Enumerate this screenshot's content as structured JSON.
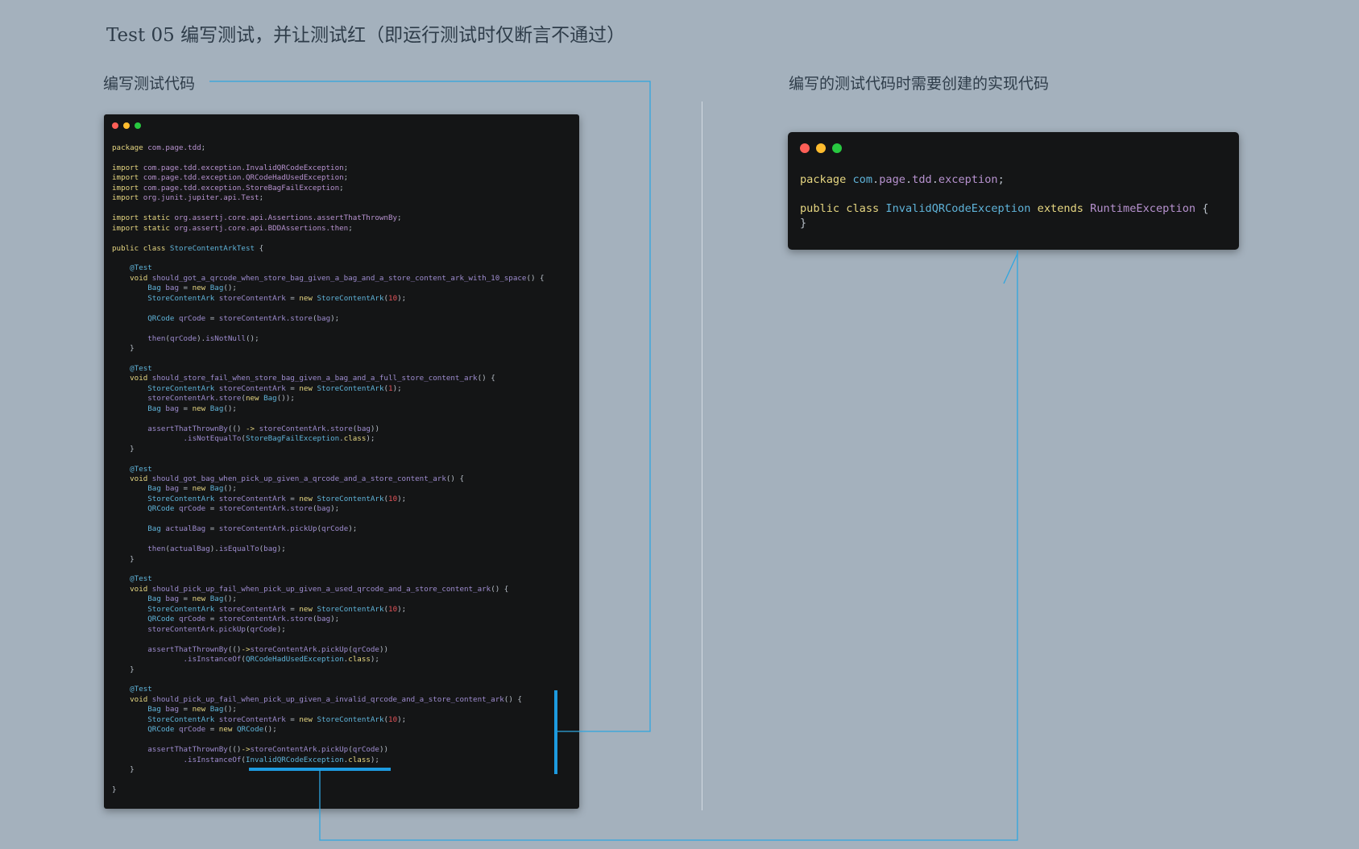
{
  "title": "Test 05 编写测试，并让测试红（即运行测试时仅断言不通过）",
  "labels": {
    "left": "编写测试代码",
    "right": "编写的测试代码时需要创建的实现代码"
  },
  "colors": {
    "background": "#a4b1bd",
    "code_background": "#141516",
    "connector": "#2fa6e0",
    "keyword": "#e6d681",
    "package": "#b792cf",
    "class": "#5fb3d9",
    "number": "#e3545a"
  },
  "left_code": [
    [
      [
        "kw",
        "package"
      ],
      [
        "pkg",
        " com.page.tdd"
      ],
      [
        "pl",
        ";"
      ]
    ],
    [],
    [
      [
        "kw",
        "import"
      ],
      [
        "pkg",
        " com.page.tdd.exception.InvalidQRCodeException"
      ],
      [
        "pl",
        ";"
      ]
    ],
    [
      [
        "kw",
        "import"
      ],
      [
        "pkg",
        " com.page.tdd.exception.QRCodeHadUsedException"
      ],
      [
        "pl",
        ";"
      ]
    ],
    [
      [
        "kw",
        "import"
      ],
      [
        "pkg",
        " com.page.tdd.exception.StoreBagFailException"
      ],
      [
        "pl",
        ";"
      ]
    ],
    [
      [
        "kw",
        "import"
      ],
      [
        "pkg",
        " org.junit.jupiter.api.Test"
      ],
      [
        "pl",
        ";"
      ]
    ],
    [],
    [
      [
        "kw",
        "import static"
      ],
      [
        "pkg",
        " org.assertj.core.api.Assertions.assertThatThrownBy"
      ],
      [
        "pl",
        ";"
      ]
    ],
    [
      [
        "kw",
        "import static"
      ],
      [
        "pkg",
        " org.assertj.core.api.BDDAssertions.then"
      ],
      [
        "pl",
        ";"
      ]
    ],
    [],
    [
      [
        "kw",
        "public class "
      ],
      [
        "cls",
        "StoreContentArkTest"
      ],
      [
        "pl",
        " {"
      ]
    ],
    [],
    [
      [
        "ann",
        "    @Test"
      ]
    ],
    [
      [
        "kw",
        "    void "
      ],
      [
        "mth",
        "should_got_a_qrcode_when_store_bag_given_a_bag_and_a_store_content_ark_with_10_space"
      ],
      [
        "pl",
        "() {"
      ]
    ],
    [
      [
        "cls",
        "        Bag"
      ],
      [
        "mth",
        " bag"
      ],
      [
        "pl",
        " = "
      ],
      [
        "kw",
        "new "
      ],
      [
        "cls",
        "Bag"
      ],
      [
        "pl",
        "();"
      ]
    ],
    [
      [
        "cls",
        "        StoreContentArk"
      ],
      [
        "mth",
        " storeContentArk"
      ],
      [
        "pl",
        " = "
      ],
      [
        "kw",
        "new "
      ],
      [
        "cls",
        "StoreContentArk"
      ],
      [
        "pl",
        "("
      ],
      [
        "num",
        "10"
      ],
      [
        "pl",
        ");"
      ]
    ],
    [],
    [
      [
        "cls",
        "        QRCode"
      ],
      [
        "mth",
        " qrCode"
      ],
      [
        "pl",
        " = "
      ],
      [
        "mth",
        "storeContentArk.store"
      ],
      [
        "pl",
        "("
      ],
      [
        "mth",
        "bag"
      ],
      [
        "pl",
        ");"
      ]
    ],
    [],
    [
      [
        "mth",
        "        then"
      ],
      [
        "pl",
        "("
      ],
      [
        "mth",
        "qrCode"
      ],
      [
        "pl",
        ")."
      ],
      [
        "mth",
        "isNotNull"
      ],
      [
        "pl",
        "();"
      ]
    ],
    [
      [
        "pl",
        "    }"
      ]
    ],
    [],
    [
      [
        "ann",
        "    @Test"
      ]
    ],
    [
      [
        "kw",
        "    void "
      ],
      [
        "mth",
        "should_store_fail_when_store_bag_given_a_bag_and_a_full_store_content_ark"
      ],
      [
        "pl",
        "() {"
      ]
    ],
    [
      [
        "cls",
        "        StoreContentArk"
      ],
      [
        "mth",
        " storeContentArk"
      ],
      [
        "pl",
        " = "
      ],
      [
        "kw",
        "new "
      ],
      [
        "cls",
        "StoreContentArk"
      ],
      [
        "pl",
        "("
      ],
      [
        "num",
        "1"
      ],
      [
        "pl",
        ");"
      ]
    ],
    [
      [
        "mth",
        "        storeContentArk.store"
      ],
      [
        "pl",
        "("
      ],
      [
        "kw",
        "new "
      ],
      [
        "cls",
        "Bag"
      ],
      [
        "pl",
        "());"
      ]
    ],
    [
      [
        "cls",
        "        Bag"
      ],
      [
        "mth",
        " bag"
      ],
      [
        "pl",
        " = "
      ],
      [
        "kw",
        "new "
      ],
      [
        "cls",
        "Bag"
      ],
      [
        "pl",
        "();"
      ]
    ],
    [],
    [
      [
        "mth",
        "        assertThatThrownBy"
      ],
      [
        "pl",
        "(() "
      ],
      [
        "kw",
        "->"
      ],
      [
        "mth",
        " storeContentArk.store"
      ],
      [
        "pl",
        "("
      ],
      [
        "mth",
        "bag"
      ],
      [
        "pl",
        "))"
      ]
    ],
    [
      [
        "mth",
        "                .isNotEqualTo"
      ],
      [
        "pl",
        "("
      ],
      [
        "cls",
        "StoreBagFailException"
      ],
      [
        "pl",
        "."
      ],
      [
        "kw",
        "class"
      ],
      [
        "pl",
        ");"
      ]
    ],
    [
      [
        "pl",
        "    }"
      ]
    ],
    [],
    [
      [
        "ann",
        "    @Test"
      ]
    ],
    [
      [
        "kw",
        "    void "
      ],
      [
        "mth",
        "should_got_bag_when_pick_up_given_a_qrcode_and_a_store_content_ark"
      ],
      [
        "pl",
        "() {"
      ]
    ],
    [
      [
        "cls",
        "        Bag"
      ],
      [
        "mth",
        " bag"
      ],
      [
        "pl",
        " = "
      ],
      [
        "kw",
        "new "
      ],
      [
        "cls",
        "Bag"
      ],
      [
        "pl",
        "();"
      ]
    ],
    [
      [
        "cls",
        "        StoreContentArk"
      ],
      [
        "mth",
        " storeContentArk"
      ],
      [
        "pl",
        " = "
      ],
      [
        "kw",
        "new "
      ],
      [
        "cls",
        "StoreContentArk"
      ],
      [
        "pl",
        "("
      ],
      [
        "num",
        "10"
      ],
      [
        "pl",
        ");"
      ]
    ],
    [
      [
        "cls",
        "        QRCode"
      ],
      [
        "mth",
        " qrCode"
      ],
      [
        "pl",
        " = "
      ],
      [
        "mth",
        "storeContentArk.store"
      ],
      [
        "pl",
        "("
      ],
      [
        "mth",
        "bag"
      ],
      [
        "pl",
        ");"
      ]
    ],
    [],
    [
      [
        "cls",
        "        Bag"
      ],
      [
        "mth",
        " actualBag"
      ],
      [
        "pl",
        " = "
      ],
      [
        "mth",
        "storeContentArk.pickUp"
      ],
      [
        "pl",
        "("
      ],
      [
        "mth",
        "qrCode"
      ],
      [
        "pl",
        ");"
      ]
    ],
    [],
    [
      [
        "mth",
        "        then"
      ],
      [
        "pl",
        "("
      ],
      [
        "mth",
        "actualBag"
      ],
      [
        "pl",
        ")."
      ],
      [
        "mth",
        "isEqualTo"
      ],
      [
        "pl",
        "("
      ],
      [
        "mth",
        "bag"
      ],
      [
        "pl",
        ");"
      ]
    ],
    [
      [
        "pl",
        "    }"
      ]
    ],
    [],
    [
      [
        "ann",
        "    @Test"
      ]
    ],
    [
      [
        "kw",
        "    void "
      ],
      [
        "mth",
        "should_pick_up_fail_when_pick_up_given_a_used_qrcode_and_a_store_content_ark"
      ],
      [
        "pl",
        "() {"
      ]
    ],
    [
      [
        "cls",
        "        Bag"
      ],
      [
        "mth",
        " bag"
      ],
      [
        "pl",
        " = "
      ],
      [
        "kw",
        "new "
      ],
      [
        "cls",
        "Bag"
      ],
      [
        "pl",
        "();"
      ]
    ],
    [
      [
        "cls",
        "        StoreContentArk"
      ],
      [
        "mth",
        " storeContentArk"
      ],
      [
        "pl",
        " = "
      ],
      [
        "kw",
        "new "
      ],
      [
        "cls",
        "StoreContentArk"
      ],
      [
        "pl",
        "("
      ],
      [
        "num",
        "10"
      ],
      [
        "pl",
        ");"
      ]
    ],
    [
      [
        "cls",
        "        QRCode"
      ],
      [
        "mth",
        " qrCode"
      ],
      [
        "pl",
        " = "
      ],
      [
        "mth",
        "storeContentArk.store"
      ],
      [
        "pl",
        "("
      ],
      [
        "mth",
        "bag"
      ],
      [
        "pl",
        ");"
      ]
    ],
    [
      [
        "mth",
        "        storeContentArk.pickUp"
      ],
      [
        "pl",
        "("
      ],
      [
        "mth",
        "qrCode"
      ],
      [
        "pl",
        ");"
      ]
    ],
    [],
    [
      [
        "mth",
        "        assertThatThrownBy"
      ],
      [
        "pl",
        "(()"
      ],
      [
        "kw",
        "->"
      ],
      [
        "mth",
        "storeContentArk.pickUp"
      ],
      [
        "pl",
        "("
      ],
      [
        "mth",
        "qrCode"
      ],
      [
        "pl",
        "))"
      ]
    ],
    [
      [
        "mth",
        "                .isInstanceOf"
      ],
      [
        "pl",
        "("
      ],
      [
        "cls",
        "QRCodeHadUsedException"
      ],
      [
        "pl",
        "."
      ],
      [
        "kw",
        "class"
      ],
      [
        "pl",
        ");"
      ]
    ],
    [
      [
        "pl",
        "    }"
      ]
    ],
    [],
    [
      [
        "ann",
        "    @Test"
      ]
    ],
    [
      [
        "kw",
        "    void "
      ],
      [
        "mth",
        "should_pick_up_fail_when_pick_up_given_a_invalid_qrcode_and_a_store_content_ark"
      ],
      [
        "pl",
        "() {"
      ]
    ],
    [
      [
        "cls",
        "        Bag"
      ],
      [
        "mth",
        " bag"
      ],
      [
        "pl",
        " = "
      ],
      [
        "kw",
        "new "
      ],
      [
        "cls",
        "Bag"
      ],
      [
        "pl",
        "();"
      ]
    ],
    [
      [
        "cls",
        "        StoreContentArk"
      ],
      [
        "mth",
        " storeContentArk"
      ],
      [
        "pl",
        " = "
      ],
      [
        "kw",
        "new "
      ],
      [
        "cls",
        "StoreContentArk"
      ],
      [
        "pl",
        "("
      ],
      [
        "num",
        "10"
      ],
      [
        "pl",
        ");"
      ]
    ],
    [
      [
        "cls",
        "        QRCode"
      ],
      [
        "mth",
        " qrCode"
      ],
      [
        "pl",
        " = "
      ],
      [
        "kw",
        "new "
      ],
      [
        "cls",
        "QRCode"
      ],
      [
        "pl",
        "();"
      ]
    ],
    [],
    [
      [
        "mth",
        "        assertThatThrownBy"
      ],
      [
        "pl",
        "(()"
      ],
      [
        "kw",
        "->"
      ],
      [
        "mth",
        "storeContentArk.pickUp"
      ],
      [
        "pl",
        "("
      ],
      [
        "mth",
        "qrCode"
      ],
      [
        "pl",
        "))"
      ]
    ],
    [
      [
        "mth",
        "                .isInstanceOf"
      ],
      [
        "pl",
        "("
      ],
      [
        "cls",
        "InvalidQRCodeException"
      ],
      [
        "pl",
        "."
      ],
      [
        "kw",
        "class"
      ],
      [
        "pl",
        ");"
      ]
    ],
    [
      [
        "pl",
        "    }"
      ]
    ],
    [],
    [
      [
        "pl",
        "}"
      ]
    ]
  ],
  "right_code": [
    [
      [
        "kw",
        "package"
      ],
      [
        "cls",
        " com"
      ],
      [
        "pl",
        "."
      ],
      [
        "pkg",
        "page"
      ],
      [
        "pl",
        "."
      ],
      [
        "pkg",
        "tdd"
      ],
      [
        "pl",
        "."
      ],
      [
        "pkg",
        "exception"
      ],
      [
        "pl",
        ";"
      ]
    ],
    [],
    [
      [
        "kw",
        "public class "
      ],
      [
        "cls",
        "InvalidQRCodeException"
      ],
      [
        "kw",
        " extends "
      ],
      [
        "pkg",
        "RuntimeException"
      ],
      [
        "pl",
        " {"
      ]
    ],
    [
      [
        "pl",
        "}"
      ]
    ]
  ]
}
